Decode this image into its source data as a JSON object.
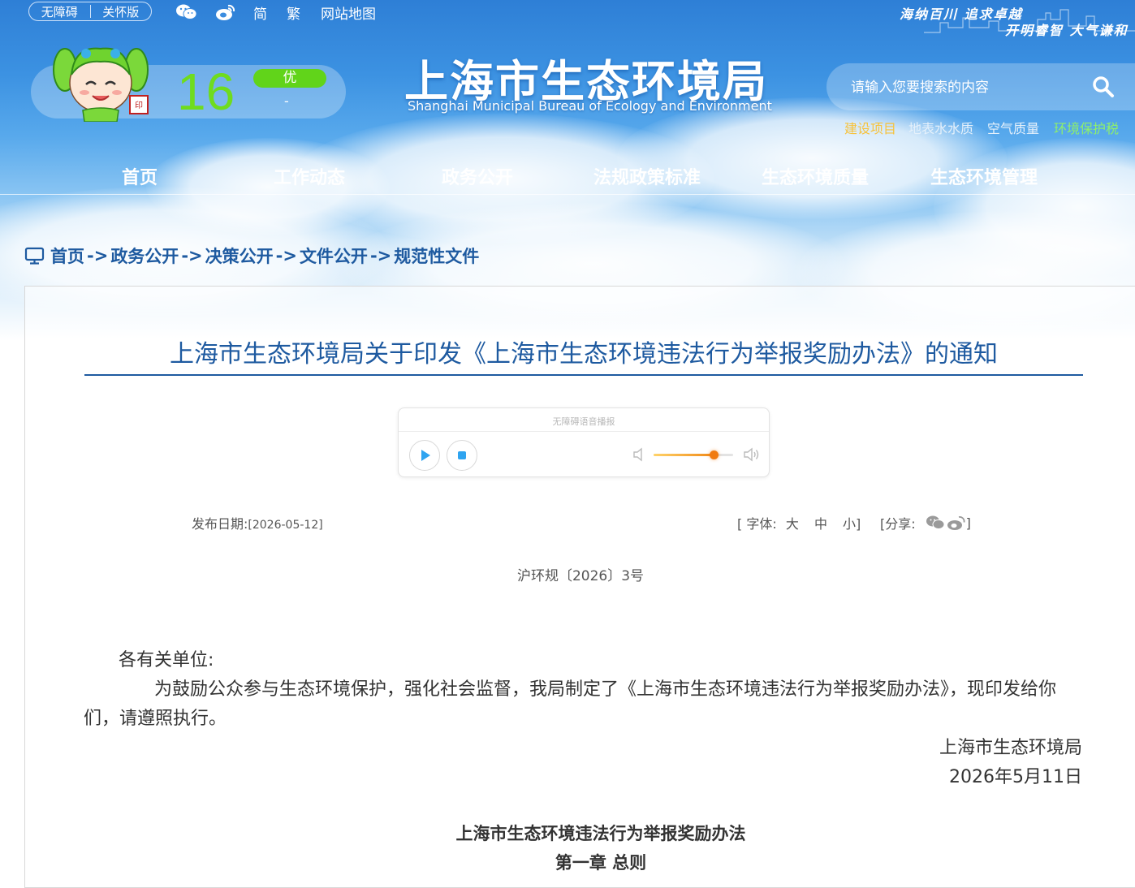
{
  "topbar": {
    "accessibility": "无障碍",
    "care_version": "关怀版",
    "simplified": "简",
    "traditional": "繁",
    "sitemap": "网站地图",
    "icons": [
      "wechat-icon",
      "weibo-icon"
    ]
  },
  "slogan": {
    "line1": "海纳百川 追求卓越",
    "line2": "开明睿智 大气谦和"
  },
  "air_quality": {
    "value": "16",
    "level": "优",
    "pollutant": "-",
    "level_color": "#61d41a"
  },
  "site": {
    "title": "上海市生态环境局",
    "subtitle": "Shanghai Municipal Bureau of Ecology and Environment"
  },
  "search": {
    "placeholder": "请输入您要搜索的内容"
  },
  "quick_links": [
    {
      "label": "建设项目",
      "color": "#f7c23a"
    },
    {
      "label": "地表水水质",
      "color": "#e6f1fb"
    },
    {
      "label": "空气质量",
      "color": "#e6f1fb"
    },
    {
      "label": "环境保护税",
      "color": "#8ff06a"
    }
  ],
  "nav": [
    "首页",
    "工作动态",
    "政务公开",
    "法规政策标准",
    "生态环境质量",
    "生态环境管理"
  ],
  "breadcrumb": [
    "首页",
    "政务公开",
    "决策公开",
    "文件公开",
    "规范性文件"
  ],
  "breadcrumb_sep": "->",
  "document": {
    "title": "上海市生态环境局关于印发《上海市生态环境违法行为举报奖励办法》的通知",
    "player_label": "无障碍语音播报",
    "volume_level": 0.75,
    "publish_label": "发布日期:",
    "publish_date": "[2026-05-12]",
    "font_label": "[ 字体:",
    "font_large": "大",
    "font_medium": "中",
    "font_small": "小]",
    "share_label": "[分享:",
    "share_end": "]",
    "doc_number": "沪环规〔2026〕3号",
    "salutation": "各有关单位:",
    "body_line1": "为鼓励公众参与生态环境保护，强化社会监督，我局制定了《上海市生态环境违法行为举报奖励办法》，现印发给你",
    "body_line2": "们，请遵照执行。",
    "signatory": "上海市生态环境局",
    "sign_date": "2026年5月11日",
    "heading": "上海市生态环境违法行为举报奖励办法",
    "chapter": "第一章 总则"
  }
}
